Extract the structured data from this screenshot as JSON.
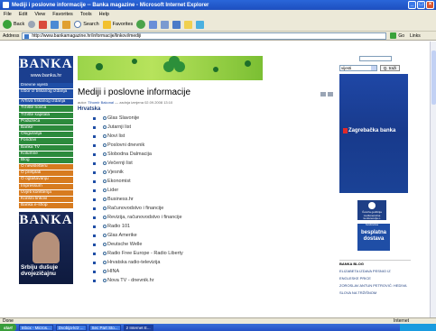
{
  "window": {
    "title": "Mediji i poslovne informacije -- Banka magazine - Microsoft Internet Explorer"
  },
  "menubar": [
    "File",
    "Edit",
    "View",
    "Favorites",
    "Tools",
    "Help"
  ],
  "toolbar": {
    "back_label": "Back",
    "search_label": "Search",
    "favorites_label": "Favorites"
  },
  "addressbar": {
    "label": "Address",
    "url": "http://www.bankamagazine.hr/informacije/linkovi/mediji",
    "go_label": "Go",
    "links_label": "Links"
  },
  "logo": {
    "name": "BANKA",
    "url": "www.banka.hr"
  },
  "nav": {
    "blue": [
      "Dnevne vijesti",
      "Izbor iz tiskanog izdanja",
      "Arhiva tiskanog izdanja"
    ],
    "green": [
      "Tržište novca",
      "Tržište kapitala",
      "Poduzeća",
      "Banke",
      "Osiguranja",
      "Fondovi",
      "Banka TV",
      "Kolumne",
      "Blog"
    ],
    "orange": [
      "O newsletteru",
      "O pretplati",
      "O oglašavanju",
      "Impressum",
      "Uvjeti korištenja",
      "Korisni linkovi",
      "Banka e-shop"
    ]
  },
  "magazine": {
    "title": "BANKA",
    "cover_text": "Srbiju dušuje dvojezičajnu"
  },
  "main": {
    "title": "Mediji i poslovne informacije",
    "meta_prefix": "autor:",
    "author": "Tihomir Bakonal",
    "meta_suffix": "— zadnja izmjena 02.09.2008 13:10",
    "section": "Hrvatska",
    "links": [
      "Glas Slavonije",
      "Jutarnji list",
      "Novi list",
      "Poslovni dnevnik",
      "Slobodna Dalmacija",
      "Večernji list",
      "Vjesnik",
      "Ekonomist",
      "Lider",
      "Business.hr",
      "Računovodstvo i financije",
      "Revizija, računovodstvo i financije",
      "Radio 101",
      "Glas Amerike",
      "Deutsche Welle",
      "Radio Free Europe - Radio Liberty",
      "Hrvatska radio-televizija",
      "HINA",
      "Nova TV - dnevnik.hr"
    ]
  },
  "search": {
    "select_value": "vijesti",
    "button_label": "Q. traži"
  },
  "ads": {
    "zaba": "Zagrebačka banka",
    "small1": "Četvrta godišnja međunarodna konferencija o investicijskim fondovima",
    "small2_line1": "besplatna",
    "small2_line2": "dostava"
  },
  "blog": {
    "heading": "BANKA BLOG",
    "item1": "ELIZABETA IZDAVA PESNIO IZ ENGLESKE PRICE",
    "item2": "ZOROSLAV ANTUN PETROVIĆ: HEDIVA SLOVA NA TRŽIŠNOM"
  },
  "status": {
    "text": "Done",
    "zone": "Internet"
  },
  "taskbar": {
    "start": "start",
    "tasks": [
      "Inbox - Micros...",
      "Dvobija-kr2 ...",
      "Sec Part Sto...",
      "2 Internet E..."
    ]
  }
}
